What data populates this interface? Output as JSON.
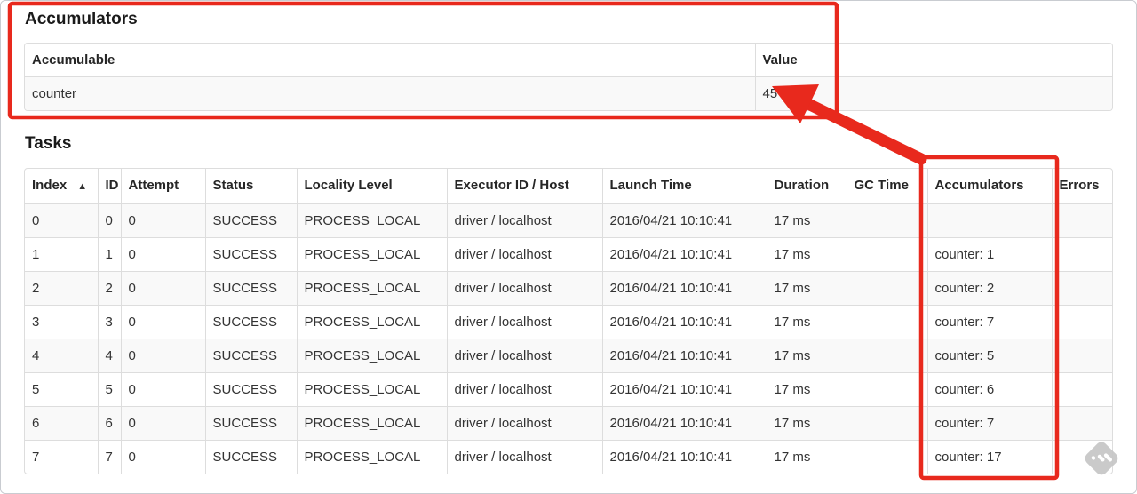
{
  "accumulators": {
    "heading": "Accumulators",
    "columns": [
      "Accumulable",
      "Value"
    ],
    "rows": [
      {
        "accumulable": "counter",
        "value": "45"
      }
    ]
  },
  "tasks": {
    "heading": "Tasks",
    "columns": [
      "Index",
      "ID",
      "Attempt",
      "Status",
      "Locality Level",
      "Executor ID / Host",
      "Launch Time",
      "Duration",
      "GC Time",
      "Accumulators",
      "Errors"
    ],
    "sorted_column": "Index",
    "sort_icon": "▲",
    "rows": [
      [
        "0",
        "0",
        "0",
        "SUCCESS",
        "PROCESS_LOCAL",
        "driver / localhost",
        "2016/04/21 10:10:41",
        "17 ms",
        "",
        "",
        ""
      ],
      [
        "1",
        "1",
        "0",
        "SUCCESS",
        "PROCESS_LOCAL",
        "driver / localhost",
        "2016/04/21 10:10:41",
        "17 ms",
        "",
        "counter: 1",
        ""
      ],
      [
        "2",
        "2",
        "0",
        "SUCCESS",
        "PROCESS_LOCAL",
        "driver / localhost",
        "2016/04/21 10:10:41",
        "17 ms",
        "",
        "counter: 2",
        ""
      ],
      [
        "3",
        "3",
        "0",
        "SUCCESS",
        "PROCESS_LOCAL",
        "driver / localhost",
        "2016/04/21 10:10:41",
        "17 ms",
        "",
        "counter: 7",
        ""
      ],
      [
        "4",
        "4",
        "0",
        "SUCCESS",
        "PROCESS_LOCAL",
        "driver / localhost",
        "2016/04/21 10:10:41",
        "17 ms",
        "",
        "counter: 5",
        ""
      ],
      [
        "5",
        "5",
        "0",
        "SUCCESS",
        "PROCESS_LOCAL",
        "driver / localhost",
        "2016/04/21 10:10:41",
        "17 ms",
        "",
        "counter: 6",
        ""
      ],
      [
        "6",
        "6",
        "0",
        "SUCCESS",
        "PROCESS_LOCAL",
        "driver / localhost",
        "2016/04/21 10:10:41",
        "17 ms",
        "",
        "counter: 7",
        ""
      ],
      [
        "7",
        "7",
        "0",
        "SUCCESS",
        "PROCESS_LOCAL",
        "driver / localhost",
        "2016/04/21 10:10:41",
        "17 ms",
        "",
        "counter: 17",
        ""
      ]
    ]
  },
  "annotations": {
    "color": "#e8291d"
  }
}
